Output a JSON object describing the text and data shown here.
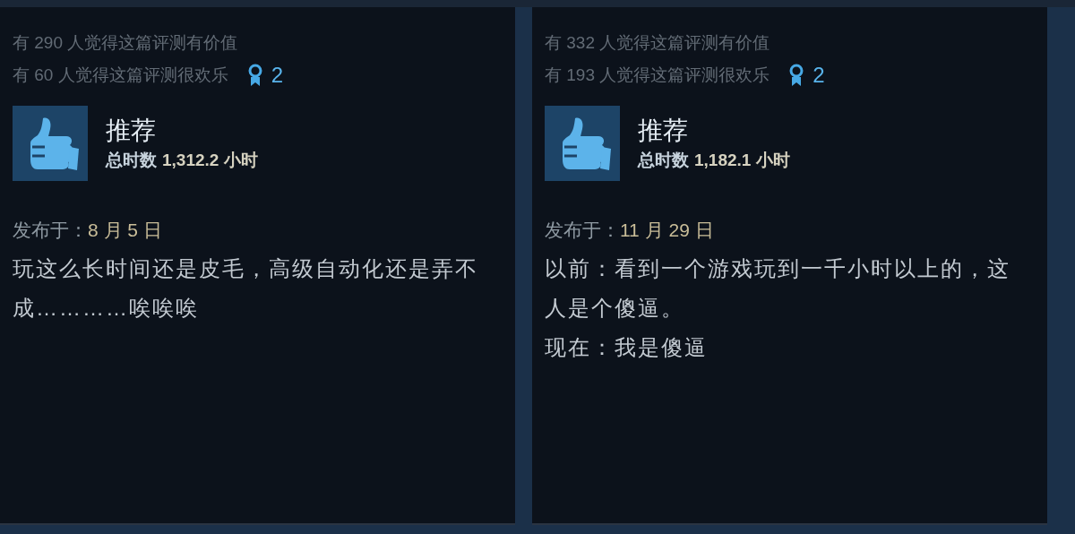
{
  "reviews": [
    {
      "helpful": "有 290 人觉得这篇评测有价值",
      "funny": "有 60 人觉得这篇评测很欢乐",
      "awards": "2",
      "verdict": "推荐",
      "recommended": true,
      "hours_label": "总时数",
      "hours": "1,312.2 小时",
      "posted_label": "发布于：",
      "posted_date": "8 月 5 日",
      "paragraphs": [
        "玩这么长时间还是皮毛，高级自动化还是弄不成…………唉唉唉"
      ]
    },
    {
      "helpful": "有 332 人觉得这篇评测有价值",
      "funny": "有 193 人觉得这篇评测很欢乐",
      "awards": "2",
      "verdict": "推荐",
      "recommended": true,
      "hours_label": "总时数",
      "hours": "1,182.1 小时",
      "posted_label": "发布于：",
      "posted_date": "11 月 29 日",
      "paragraphs": [
        "以前：看到一个游戏玩到一千小时以上的，这人是个傻逼。",
        "现在：我是傻逼"
      ]
    }
  ]
}
